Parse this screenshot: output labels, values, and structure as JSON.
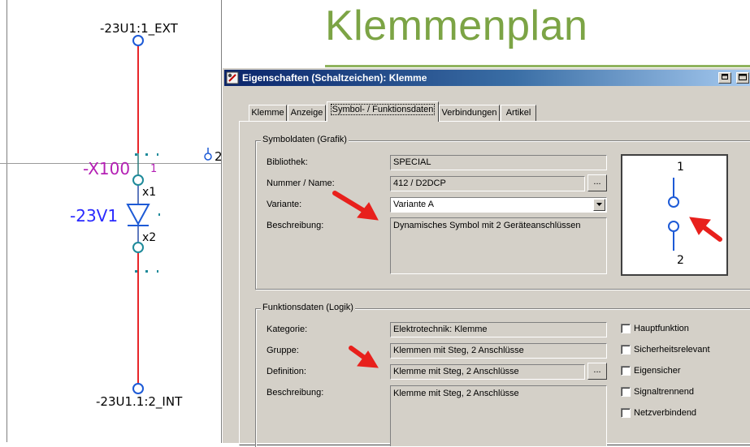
{
  "schematic": {
    "page_title": "Klemmenplan",
    "top_connection": "-23U1:1_EXT",
    "bottom_connection": "-23U1.1:2_INT",
    "terminal_tag": "-X100",
    "terminal_pin": "1",
    "device_tag": "-23V1",
    "pin_x1": "x1",
    "pin_x2": "x2",
    "side_number": "2",
    "colors": {
      "wire": "#e8262a",
      "symbol": "#1d5ad6",
      "tag_terminal": "#b41fb4",
      "tag_device": "#2a2aff",
      "title": "#7ca445"
    }
  },
  "dialog": {
    "title": "Eigenschaften (Schaltzeichen): Klemme",
    "icon": "app-icon",
    "window_buttons": [
      "restore-icon",
      "maximize-icon"
    ],
    "tabs": [
      {
        "label": "Klemme",
        "active": false
      },
      {
        "label": "Anzeige",
        "active": false
      },
      {
        "label": "Symbol- / Funktionsdaten",
        "active": true
      },
      {
        "label": "Verbindungen",
        "active": false
      },
      {
        "label": "Artikel",
        "active": false
      }
    ],
    "symbol_group": {
      "title": "Symboldaten (Grafik)",
      "library_label": "Bibliothek:",
      "library_value": "SPECIAL",
      "number_label": "Nummer / Name:",
      "number_value": "412 / D2DCP",
      "number_button": "...",
      "variant_label": "Variante:",
      "variant_value": "Variante A",
      "description_label": "Beschreibung:",
      "description_value": "Dynamisches Symbol mit 2 Geräteanschlüssen",
      "preview_pin_top": "1",
      "preview_pin_bottom": "2"
    },
    "function_group": {
      "title": "Funktionsdaten (Logik)",
      "category_label": "Kategorie:",
      "category_value": "Elektrotechnik: Klemme",
      "group_label": "Gruppe:",
      "group_value": "Klemmen mit Steg, 2 Anschlüsse",
      "definition_label": "Definition:",
      "definition_value": "Klemme mit Steg, 2 Anschlüsse",
      "definition_button": "...",
      "description_label": "Beschreibung:",
      "description_value": "Klemme mit Steg, 2 Anschlüsse",
      "checkboxes": [
        {
          "label": "Hauptfunktion",
          "checked": false
        },
        {
          "label": "Sicherheitsrelevant",
          "checked": false
        },
        {
          "label": "Eigensicher",
          "checked": false
        },
        {
          "label": "Signaltrennend",
          "checked": false
        },
        {
          "label": "Netzverbindend",
          "checked": false
        }
      ]
    },
    "annotation_color": "#e8201c"
  }
}
